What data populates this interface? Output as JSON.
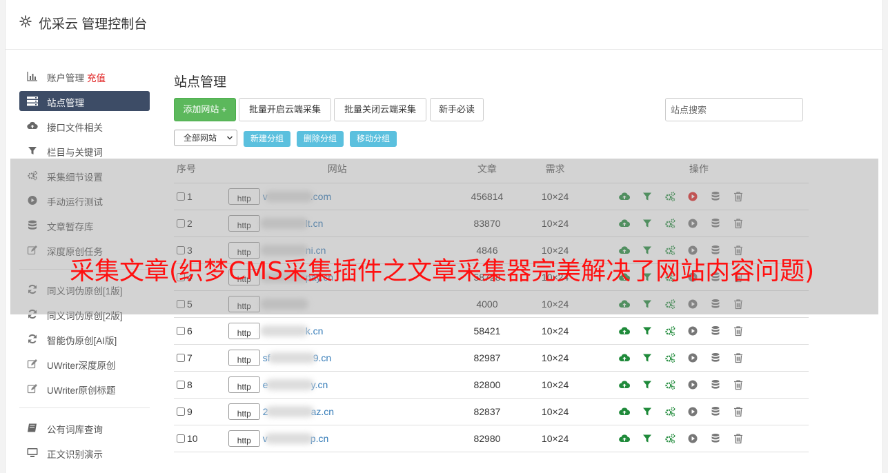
{
  "header": {
    "title": "优采云 管理控制台",
    "icon": "gear-icon"
  },
  "sidebar": {
    "items": [
      {
        "label": "账户管理",
        "extra": "充值",
        "icon": "bar-chart-icon"
      },
      {
        "label": "站点管理",
        "icon": "server-list-icon"
      },
      {
        "label": "接口文件相关",
        "icon": "cloud-upload-icon"
      },
      {
        "label": "栏目与关键词",
        "icon": "filter-icon"
      },
      {
        "label": "采集细节设置",
        "icon": "gears-icon"
      },
      {
        "label": "手动运行测试",
        "icon": "play-circle-icon"
      },
      {
        "label": "文章暂存库",
        "icon": "database-icon"
      },
      {
        "label": "深度原创任务",
        "icon": "edit-icon"
      },
      {
        "label": "同义词伪原创[1版]",
        "icon": "refresh-icon"
      },
      {
        "label": "同义词伪原创[2版]",
        "icon": "refresh-icon"
      },
      {
        "label": "智能伪原创[AI版]",
        "icon": "refresh-icon"
      },
      {
        "label": "UWriter深度原创",
        "icon": "edit-icon"
      },
      {
        "label": "UWriter原创标题",
        "icon": "edit-icon"
      },
      {
        "label": "公有词库查询",
        "icon": "book-icon"
      },
      {
        "label": "正文识别演示",
        "icon": "monitor-icon"
      }
    ]
  },
  "main": {
    "title": "站点管理",
    "toolbar": {
      "add_site": "添加网站 +",
      "batch_enable": "批量开启云端采集",
      "batch_disable": "批量关闭云端采集",
      "beginner": "新手必读",
      "search_placeholder": "站点搜索"
    },
    "group_select": "全部网站",
    "group_buttons": {
      "new": "新建分组",
      "delete": "删除分组",
      "move": "移动分组"
    },
    "table": {
      "headers": {
        "no": "序号",
        "site": "网站",
        "articles": "文章",
        "demand": "需求",
        "ops": "操作"
      },
      "rows": [
        {
          "no": "1",
          "protocol": "http",
          "prefix": "v",
          "suffix": ".com",
          "articles": "456814",
          "demand": "10×24",
          "active": true
        },
        {
          "no": "2",
          "protocol": "http",
          "prefix": "",
          "suffix": "lt.cn",
          "articles": "83870",
          "demand": "10×24",
          "active": false
        },
        {
          "no": "3",
          "protocol": "http",
          "prefix": "",
          "suffix": "ni.cn",
          "articles": "4846",
          "demand": "10×24",
          "active": false
        },
        {
          "no": "4",
          "protocol": "http",
          "prefix": "",
          "suffix": "pay.cn",
          "articles": "58728",
          "demand": "10×24",
          "active": false
        },
        {
          "no": "5",
          "protocol": "http",
          "prefix": "",
          "suffix": "",
          "articles": "4000",
          "demand": "10×24",
          "active": false
        },
        {
          "no": "6",
          "protocol": "http",
          "prefix": "",
          "suffix": "k.cn",
          "articles": "58421",
          "demand": "10×24",
          "active": false
        },
        {
          "no": "7",
          "protocol": "http",
          "prefix": "sf",
          "suffix": "9.cn",
          "articles": "82987",
          "demand": "10×24",
          "active": false
        },
        {
          "no": "8",
          "protocol": "http",
          "prefix": "e",
          "suffix": "y.cn",
          "articles": "82800",
          "demand": "10×24",
          "active": false
        },
        {
          "no": "9",
          "protocol": "http",
          "prefix": "2",
          "suffix": "az.cn",
          "articles": "82837",
          "demand": "10×24",
          "active": false
        },
        {
          "no": "10",
          "protocol": "http",
          "prefix": "v",
          "suffix": "p.cn",
          "articles": "82980",
          "demand": "10×24",
          "active": false
        }
      ]
    }
  },
  "overlay": {
    "text": "采集文章(织梦CMS采集插件之文章采集器完美解决了网站内容问题)"
  },
  "colors": {
    "green": "#1f8a3a",
    "red_play": "#e02424",
    "grey_icon": "#777777",
    "active_nav": "#3d4c66",
    "link": "#337ab7"
  }
}
